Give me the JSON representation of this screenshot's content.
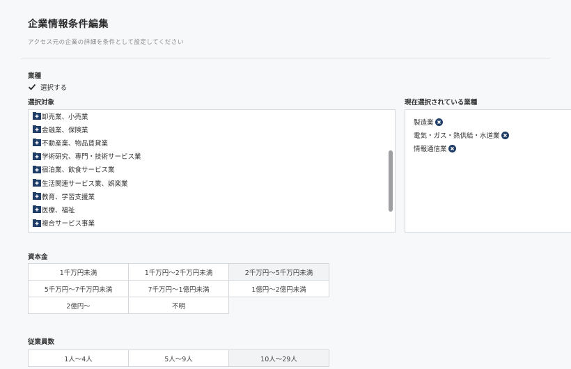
{
  "header": {
    "title": "企業情報条件編集",
    "subtitle": "アクセス元の企業の詳細を条件として設定してください"
  },
  "industry": {
    "label": "業種",
    "select_checkbox_label": "選択する",
    "select_checked": true,
    "target_label": "選択対象",
    "items": [
      "卸売業、小売業",
      "金融業、保険業",
      "不動産業、物品賃貸業",
      "学術研究、専門・技術サービス業",
      "宿泊業、飲食サービス業",
      "生活関連サービス業、娯楽業",
      "教育、学習支援業",
      "医療、福祉",
      "複合サービス事業"
    ],
    "selected_label": "現在選択されている業種",
    "selected_items": [
      "製造業",
      "電気・ガス・熱供給・水道業",
      "情報通信業"
    ]
  },
  "capital": {
    "label": "資本金",
    "options": [
      "1千万円未満",
      "1千万円～2千万円未満",
      "2千万円～5千万円未満",
      "5千万円～7千万円未満",
      "7千万円～1億円未満",
      "1億円～2億円未満",
      "2億円～",
      "不明"
    ]
  },
  "employees": {
    "label": "従業員数",
    "options": [
      "1人～4人",
      "5人～9人",
      "10人～29人"
    ]
  },
  "colors": {
    "icon": "#1f3d66",
    "checkbox": "#2a2a2a",
    "border": "#d4d7dc"
  }
}
